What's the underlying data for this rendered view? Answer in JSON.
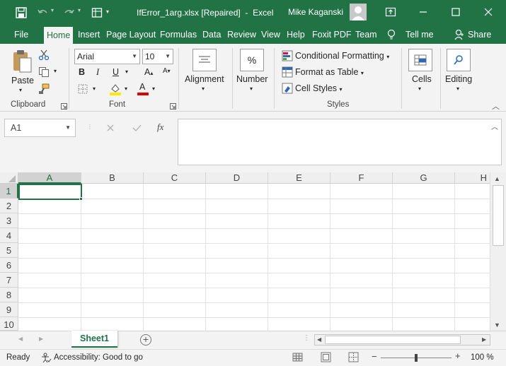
{
  "titlebar": {
    "filename": "IfError_1arg.xlsx [Repaired]",
    "separator": "-",
    "app": "Excel",
    "user": "Mike Kaganski"
  },
  "tabs": [
    "File",
    "Home",
    "Insert",
    "Page Layout",
    "Formulas",
    "Data",
    "Review",
    "View",
    "Help",
    "Foxit PDF",
    "Team"
  ],
  "tellme": "Tell me",
  "share": "Share",
  "ribbon": {
    "clipboard": {
      "paste": "Paste",
      "label": "Clipboard"
    },
    "font": {
      "name": "Arial",
      "size": "10",
      "bold": "B",
      "italic": "I",
      "underline": "U",
      "grow": "A",
      "shrink": "A",
      "fontcolor": "A",
      "label": "Font"
    },
    "alignment": {
      "label": "Alignment"
    },
    "number": {
      "label": "Number",
      "icon": "%"
    },
    "styles": {
      "conditional": "Conditional Formatting",
      "table": "Format as Table",
      "cellstyles": "Cell Styles",
      "label": "Styles"
    },
    "cells": {
      "label": "Cells"
    },
    "editing": {
      "label": "Editing"
    }
  },
  "formulabar": {
    "namebox": "A1",
    "fx": "fx",
    "value": ""
  },
  "grid": {
    "columns": [
      "A",
      "B",
      "C",
      "D",
      "E",
      "F",
      "G",
      "H"
    ],
    "rows": [
      "1",
      "2",
      "3",
      "4",
      "5",
      "6",
      "7",
      "8",
      "9",
      "10"
    ],
    "selected": "A1"
  },
  "sheets": {
    "active": "Sheet1"
  },
  "status": {
    "ready": "Ready",
    "accessibility": "Accessibility: Good to go",
    "zoom": "100 %"
  },
  "colors": {
    "accent": "#217346",
    "ribbon": "#f3f3f3"
  }
}
